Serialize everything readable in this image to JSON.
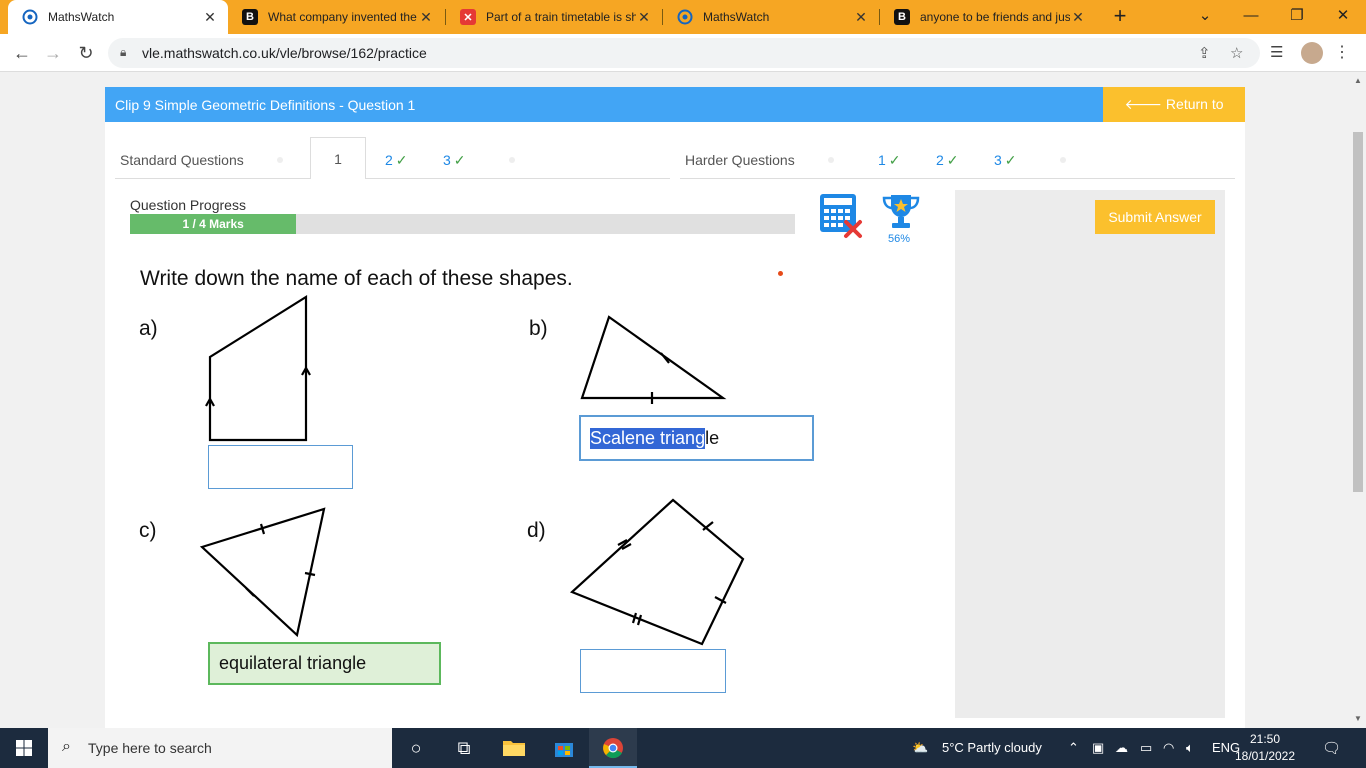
{
  "browser": {
    "tabs": [
      {
        "title": "MathsWatch",
        "favicon": "mathswatch-icon",
        "active": true
      },
      {
        "title": "What company invented the",
        "favicon": "brainly-icon"
      },
      {
        "title": "Part of a train timetable is sh",
        "favicon": "x-icon"
      },
      {
        "title": "MathsWatch",
        "favicon": "mathswatch-icon"
      },
      {
        "title": "anyone to be friends and jus",
        "favicon": "brainly-icon"
      }
    ],
    "url": "vle.mathswatch.co.uk/vle/browse/162/practice"
  },
  "header": {
    "title": "Clip 9 Simple Geometric Definitions - Question 1",
    "return_label": "Return to Videos",
    "return_icon": "arrow-left-icon"
  },
  "question_tabs": {
    "standard_label": "Standard Questions",
    "standard": [
      {
        "label": "1",
        "tick": ""
      },
      {
        "label": "2",
        "tick": "✓"
      },
      {
        "label": "3",
        "tick": "✓"
      }
    ],
    "harder_label": "Harder Questions",
    "harder": [
      {
        "label": "1",
        "tick": "✓"
      },
      {
        "label": "2",
        "tick": "✓"
      },
      {
        "label": "3",
        "tick": "✓"
      }
    ]
  },
  "progress": {
    "label": "Question Progress",
    "text": "1 / 4 Marks",
    "fraction": 0.25,
    "fill_color": "#66bb6a"
  },
  "tools": {
    "calculator_icon": "calculator-not-allowed-icon",
    "trophy_icon": "trophy-icon",
    "trophy_percent": "56%"
  },
  "submit_label": "Submit Answer",
  "question": {
    "prompt": "Write down the name of each of these shapes.",
    "parts": [
      {
        "label": "a)",
        "answer": "",
        "state": "empty"
      },
      {
        "label": "b)",
        "answer_selected": "Scalene triang",
        "answer_rest": "le",
        "state": "focused"
      },
      {
        "label": "c)",
        "answer": "equilateral triangle",
        "state": "correct"
      },
      {
        "label": "d)",
        "answer": "",
        "state": "empty"
      }
    ]
  },
  "taskbar": {
    "search_placeholder": "Type here to search",
    "weather": "5°C  Partly cloudy",
    "language": "ENG",
    "time": "21:50",
    "date": "18/01/2022"
  },
  "colors": {
    "header_blue": "#42a5f5",
    "accent_yellow": "#fbc02d",
    "correct_green": "#5cb85c",
    "chrome_tabstrip": "#f6a623"
  }
}
